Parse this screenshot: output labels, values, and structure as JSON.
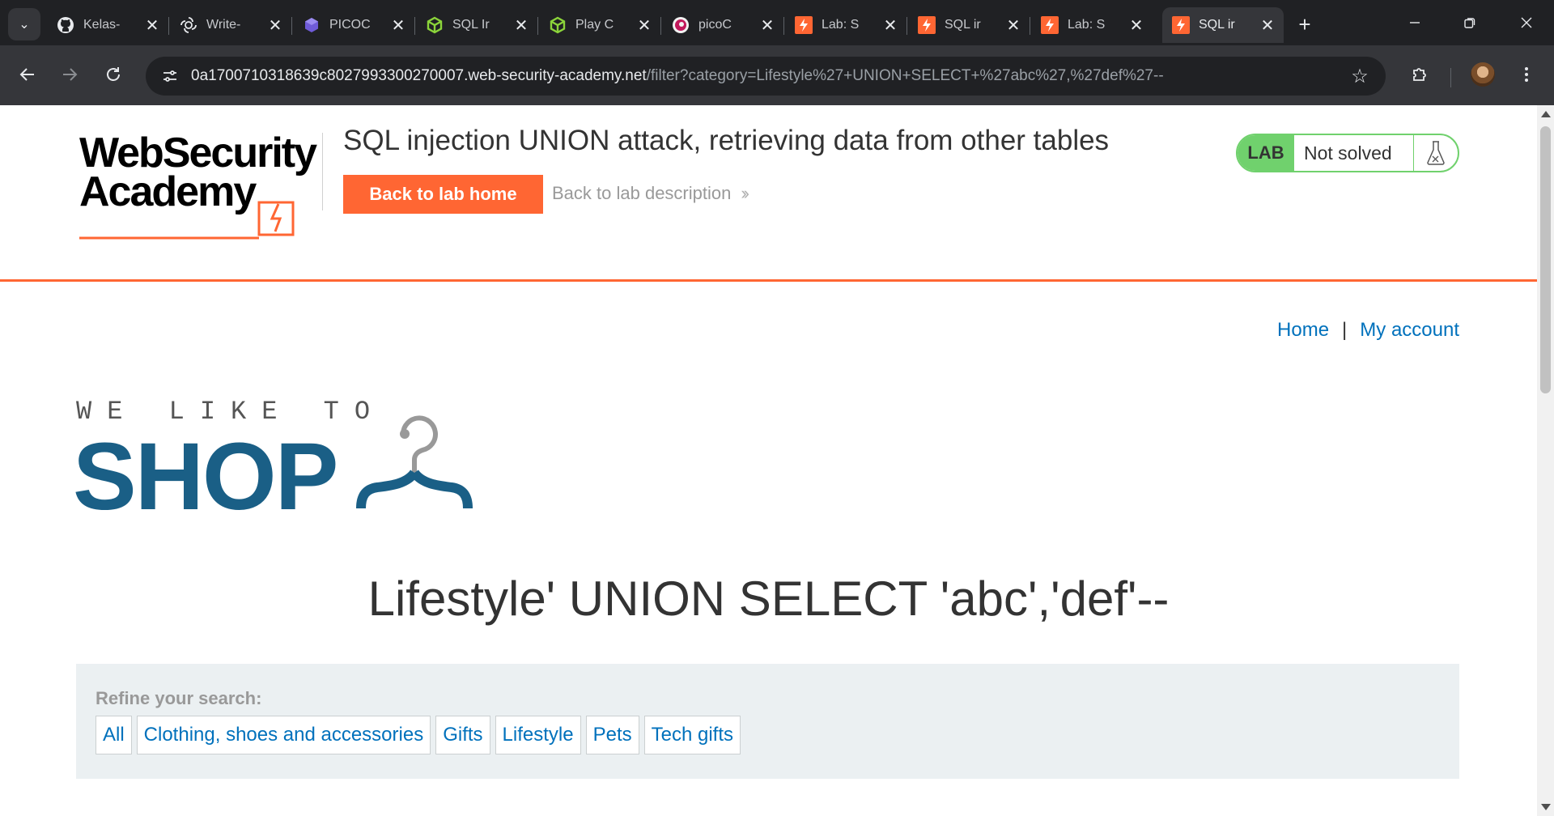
{
  "browser": {
    "tabs": [
      {
        "title": "Kelas-",
        "icon": "github-icon",
        "active": false
      },
      {
        "title": "Write-",
        "icon": "chatgpt-icon",
        "active": false
      },
      {
        "title": "PICOC",
        "icon": "picoctf-box-icon",
        "active": false
      },
      {
        "title": "SQL Ir",
        "icon": "green-cube-icon",
        "active": false
      },
      {
        "title": "Play C",
        "icon": "green-cube-icon",
        "active": false
      },
      {
        "title": "picoC",
        "icon": "picoctf-circle-icon",
        "active": false
      },
      {
        "title": "Lab: S",
        "icon": "portswigger-icon",
        "active": false
      },
      {
        "title": "SQL ir",
        "icon": "portswigger-icon",
        "active": false
      },
      {
        "title": "Lab: S",
        "icon": "portswigger-icon",
        "active": false
      },
      {
        "title": "SQL ir",
        "icon": "portswigger-icon",
        "active": true
      }
    ],
    "url_host": "0a1700710318639c8027993300270007.web-security-academy.net",
    "url_path": "/filter?category=Lifestyle%27+UNION+SELECT+%27abc%27,%27def%27--"
  },
  "academy": {
    "logo_line1": "WebSecurity",
    "logo_line2": "Academy",
    "lab_title": "SQL injection UNION attack, retrieving data from other tables",
    "back_home_label": "Back to lab home",
    "back_desc_label": "Back to lab description",
    "lab_badge": "LAB",
    "lab_status": "Not solved"
  },
  "shop": {
    "nav": {
      "home": "Home",
      "separator": "|",
      "account": "My account"
    },
    "logo_top": "WE LIKE TO",
    "logo_main": "SHOP",
    "heading": "Lifestyle' UNION SELECT 'abc','def'--",
    "refine_label": "Refine your search:",
    "filters": [
      "All",
      "Clothing, shoes and accessories",
      "Gifts",
      "Lifestyle",
      "Pets",
      "Tech gifts"
    ]
  },
  "colors": {
    "accent_orange": "#ff6633",
    "lab_green": "#70d16d",
    "link_blue": "#0071bc",
    "shop_blue": "#1a5f86"
  }
}
